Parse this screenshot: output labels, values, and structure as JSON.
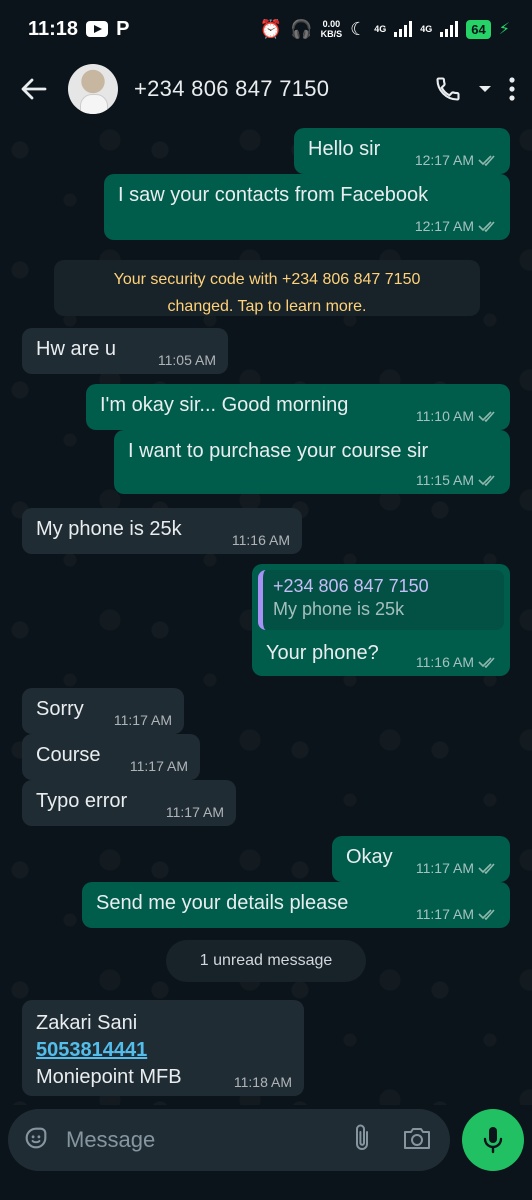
{
  "status_bar": {
    "time": "11:18",
    "data_speed_value": "0.00",
    "data_speed_unit": "KB/S",
    "net1": "4G",
    "net2": "4G",
    "battery": "64"
  },
  "header": {
    "contact": "+234 806 847 7150"
  },
  "system_note": {
    "line1": "Your security code with +234 806 847 7150",
    "line2": "changed. Tap to learn more."
  },
  "messages": [
    {
      "dir": "out",
      "text": "Hello sir",
      "time": "12:17 AM"
    },
    {
      "dir": "out",
      "text": "I saw your contacts from Facebook",
      "time": "12:17 AM"
    },
    {
      "dir": "in",
      "text": "Hw are u",
      "time": "11:05 AM"
    },
    {
      "dir": "out",
      "text": "I'm okay sir... Good morning",
      "time": "11:10 AM"
    },
    {
      "dir": "out",
      "text": "I want to purchase your course sir",
      "time": "11:15 AM"
    },
    {
      "dir": "in",
      "text": "My phone is 25k",
      "time": "11:16 AM"
    },
    {
      "dir": "out",
      "text": "Your phone?",
      "time": "11:16 AM",
      "quote_name": "+234 806 847 7150",
      "quote_text": "My phone is 25k"
    },
    {
      "dir": "in",
      "text": "Sorry",
      "time": "11:17 AM"
    },
    {
      "dir": "in",
      "text": "Course",
      "time": "11:17 AM"
    },
    {
      "dir": "in",
      "text": "Typo error",
      "time": "11:17 AM"
    },
    {
      "dir": "out",
      "text": "Okay",
      "time": "11:17 AM"
    },
    {
      "dir": "out",
      "text": "Send me your details please",
      "time": "11:17 AM"
    },
    {
      "dir": "in",
      "line1": "Zakari Sani",
      "link": "5053814441",
      "line3": "Moniepoint MFB",
      "time": "11:18 AM"
    }
  ],
  "unread": "1 unread message",
  "input": {
    "placeholder": "Message"
  },
  "colors": {
    "outgoing_bubble": "#005c4b",
    "incoming_bubble": "#202c33",
    "accent_green": "#21c063",
    "link_blue": "#53bdeb",
    "system_note_text": "#ffd279"
  }
}
